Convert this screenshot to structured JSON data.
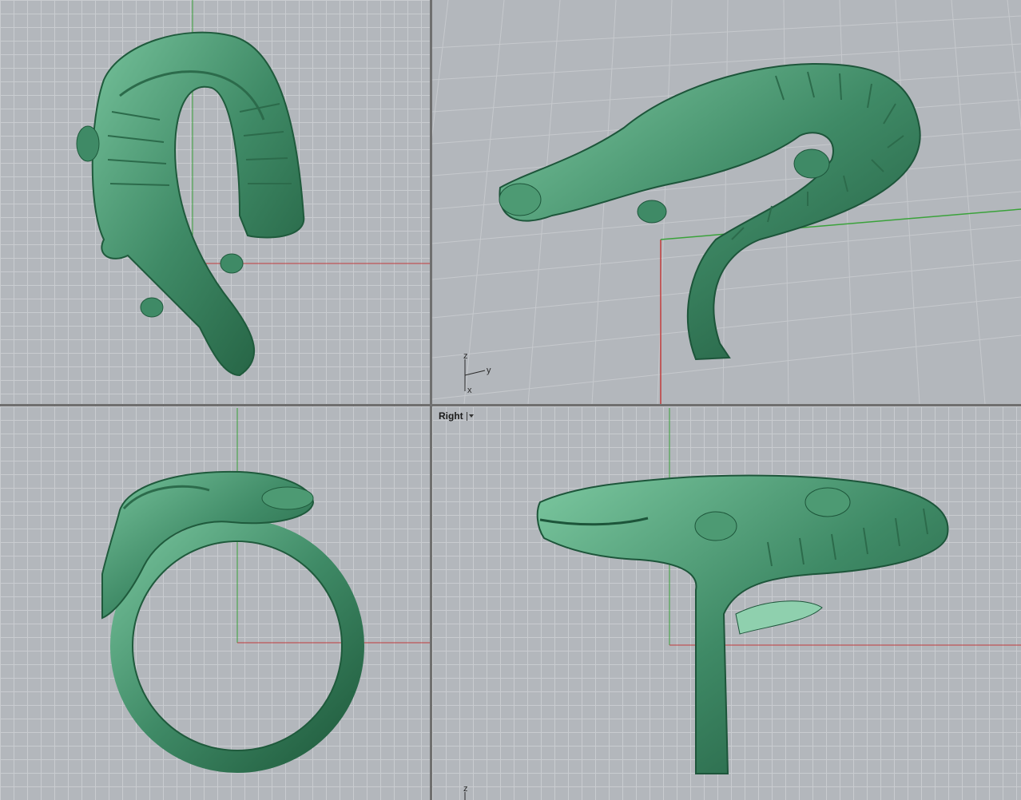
{
  "viewports": {
    "top": {
      "label": "",
      "icon": "top-view"
    },
    "perspective": {
      "label": "",
      "axis_widget": {
        "z": "z",
        "y": "y",
        "x": "x"
      }
    },
    "front": {
      "label": "",
      "icon": "front-view"
    },
    "right": {
      "label": "Right",
      "menu_icon": "dropdown-caret-icon",
      "axis_widget": {
        "z": "z"
      }
    }
  },
  "colors": {
    "grid_bg": "#b3b7bc",
    "grid_minor": "#c9ccd0",
    "grid_major": "#a4a8ad",
    "axis_x": "#c23b3b",
    "axis_y": "#3aa23a",
    "model": "#3f8a66",
    "model_light": "#6bb590",
    "model_dark": "#1f5a3c"
  }
}
